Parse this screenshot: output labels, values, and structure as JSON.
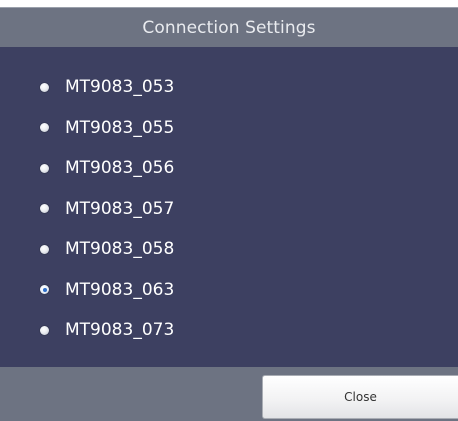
{
  "dialog": {
    "title": "Connection Settings",
    "selected_index": 5,
    "options": [
      {
        "label": "MT9083_053",
        "selected": false
      },
      {
        "label": "MT9083_055",
        "selected": false
      },
      {
        "label": "MT9083_056",
        "selected": false
      },
      {
        "label": "MT9083_057",
        "selected": false
      },
      {
        "label": "MT9083_058",
        "selected": false
      },
      {
        "label": "MT9083_063",
        "selected": true
      },
      {
        "label": "MT9083_073",
        "selected": false
      }
    ],
    "close_label": "Close"
  },
  "colors": {
    "titlebar_bg": "#6d7382",
    "body_bg": "#3d4061",
    "footer_bg": "#6d7382",
    "text": "#ffffff",
    "radio_dot_selected": "#2f6fcb"
  },
  "icons": {
    "radio_unselected": "radio-unselected-icon",
    "radio_selected": "radio-selected-icon"
  }
}
